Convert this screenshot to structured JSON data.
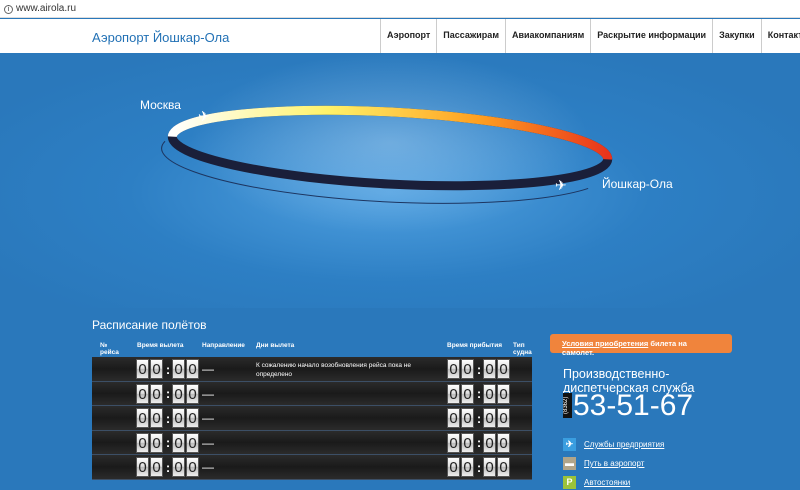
{
  "browser": {
    "url": "www.airola.ru"
  },
  "header": {
    "logo": "Аэропорт Йошкар-Ола",
    "nav": [
      "Аэропорт",
      "Пассажирам",
      "Авиакомпаниям",
      "Раскрытие информации",
      "Закупки",
      "Контакты"
    ]
  },
  "hero": {
    "city_from": "Москва",
    "city_to": "Йошкар-Ола"
  },
  "schedule": {
    "title": "Расписание полётов",
    "columns": [
      "№ рейса",
      "Время вылета",
      "Направление",
      "Дни вылета",
      "Время прибытия",
      "Тип судна"
    ],
    "rows": [
      {
        "dep": [
          "0",
          "0",
          "0",
          "0"
        ],
        "dir": "—",
        "days": "К сожалению начало возобновления рейса пока не определено",
        "arr": [
          "0",
          "0",
          "0",
          "0"
        ]
      },
      {
        "dep": [
          "0",
          "0",
          "0",
          "0"
        ],
        "dir": "—",
        "days": "",
        "arr": [
          "0",
          "0",
          "0",
          "0"
        ]
      },
      {
        "dep": [
          "0",
          "0",
          "0",
          "0"
        ],
        "dir": "—",
        "days": "",
        "arr": [
          "0",
          "0",
          "0",
          "0"
        ]
      },
      {
        "dep": [
          "0",
          "0",
          "0",
          "0"
        ],
        "dir": "—",
        "days": "",
        "arr": [
          "0",
          "0",
          "0",
          "0"
        ]
      },
      {
        "dep": [
          "0",
          "0",
          "0",
          "0"
        ],
        "dir": "—",
        "days": "",
        "arr": [
          "0",
          "0",
          "0",
          "0"
        ]
      }
    ]
  },
  "sidebar": {
    "ticket_link": "Условия приобретения",
    "ticket_rest": " билета на самолет.",
    "service": "Производственно-диспетчерская служба",
    "code": "(8362)",
    "phone": "53-51-67",
    "links": [
      {
        "label": "Службы предприятия",
        "icon": "plane-icon",
        "color": "#3a9ee0"
      },
      {
        "label": "Путь в аэропорт",
        "icon": "bus-icon",
        "color": "#b0a58a"
      },
      {
        "label": "Автостоянки",
        "icon": "parking-icon",
        "color": "#9cc23a"
      }
    ]
  }
}
